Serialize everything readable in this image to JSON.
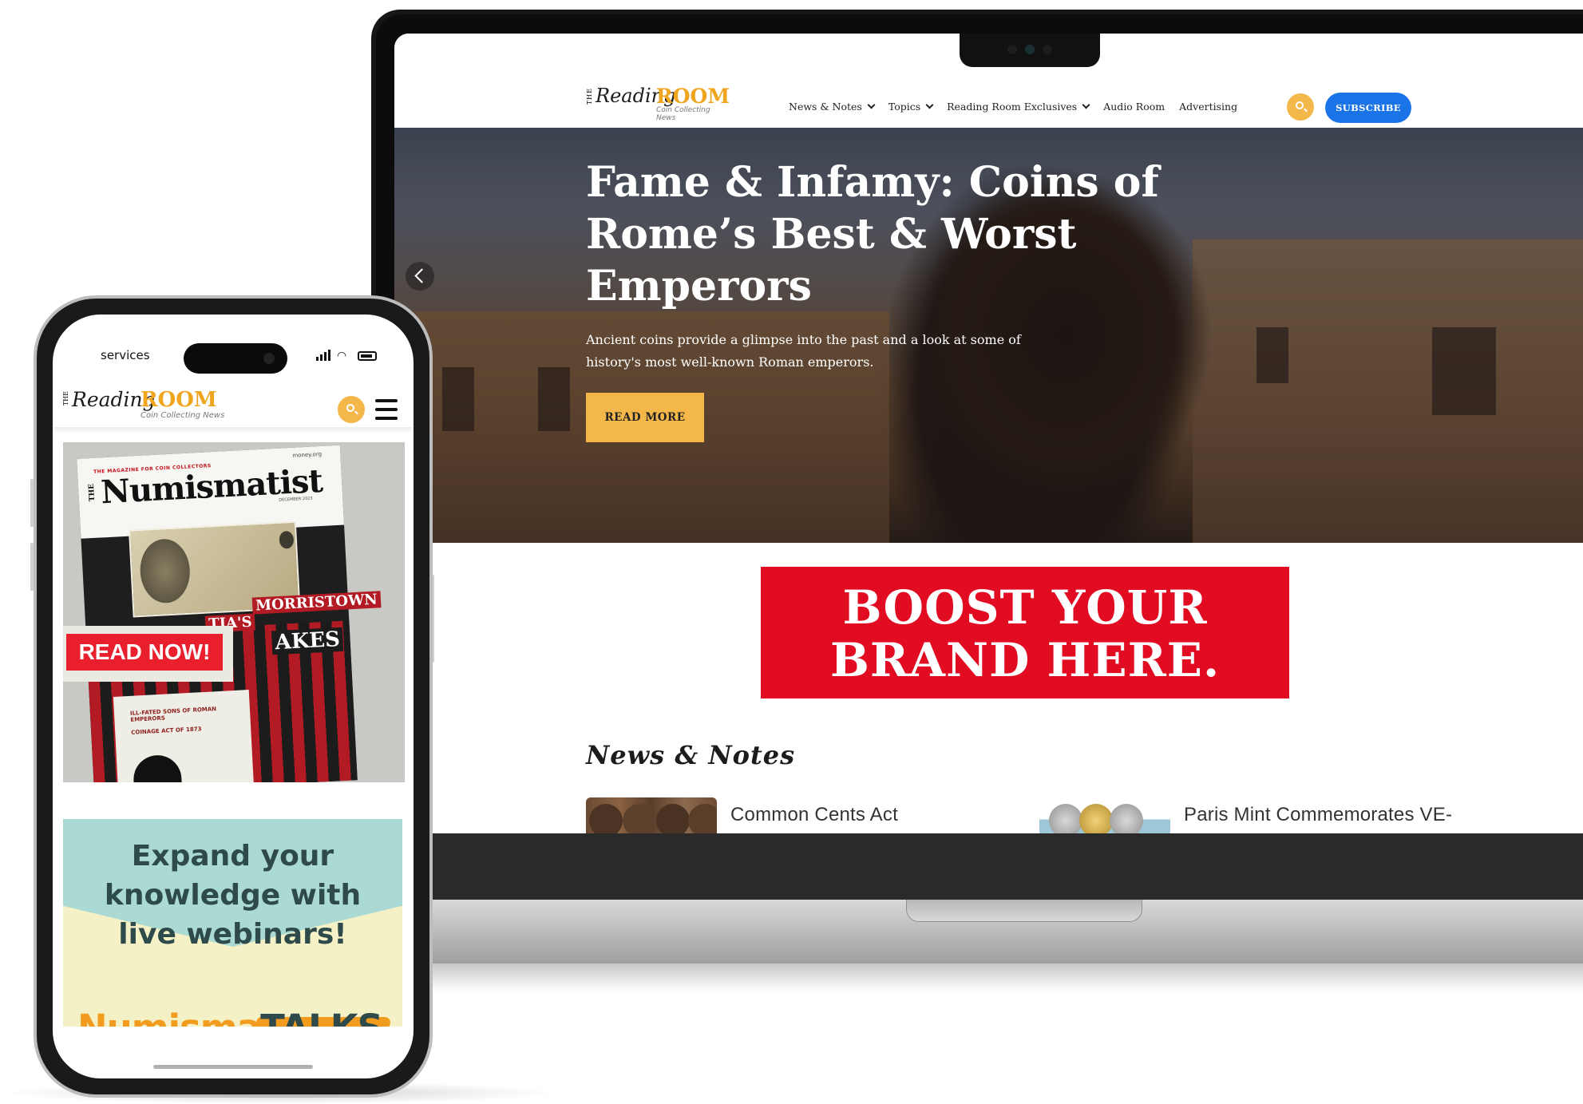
{
  "laptop": {
    "site": {
      "logo": {
        "the": "THE",
        "reading": "Reading",
        "room": "ROOM",
        "tagline": "Coin Collecting News"
      },
      "nav": [
        {
          "label": "News & Notes",
          "dropdown": true
        },
        {
          "label": "Topics",
          "dropdown": true
        },
        {
          "label": "Reading Room Exclusives",
          "dropdown": true
        },
        {
          "label": "Audio Room",
          "dropdown": false
        },
        {
          "label": "Advertising",
          "dropdown": false
        }
      ],
      "search_icon": "search-icon",
      "subscribe_label": "SUBSCRIBE",
      "hero": {
        "title": "Fame & Infamy: Coins of Rome’s Best & Worst Emperors",
        "description": "Ancient coins provide a glimpse into the past and a look at some of history's most well-known Roman emperors.",
        "cta": "READ MORE"
      },
      "ad": {
        "line1": "BOOST YOUR",
        "line2": "BRAND HERE."
      },
      "news": {
        "heading": "News & Notes",
        "items": [
          {
            "title": "Common Cents Act"
          },
          {
            "title": "Paris Mint Commemorates VE-"
          }
        ]
      }
    }
  },
  "phone": {
    "status": {
      "left": "services"
    },
    "logo": {
      "the": "THE",
      "reading": "Reading",
      "room": "ROOM",
      "tagline": "Coin Collecting News"
    },
    "magazine": {
      "kicker": "THE MAGAZINE FOR COIN COLLECTORS",
      "the": "THE",
      "name": "Numismatist",
      "url": "money.org",
      "date": "DECEMBER 2023",
      "cover_words": [
        "TIA'S",
        "MORRISTOWN",
        "AKES"
      ],
      "bullets": [
        "ILL-FATED SONS OF ROMAN EMPERORS",
        "COINAGE ACT OF 1873"
      ],
      "read_now": "READ NOW!"
    },
    "webinar": {
      "headline_l1": "Expand your",
      "headline_l2": "knowledge with",
      "headline_l3": "live webinars!",
      "brand_a": "Numisma",
      "brand_b": "TALKS"
    }
  },
  "colors": {
    "accent_yellow": "#f4b84a",
    "subscribe_blue": "#1b73e8",
    "ad_red": "#e10b22",
    "brand_orange": "#f0a51e"
  }
}
